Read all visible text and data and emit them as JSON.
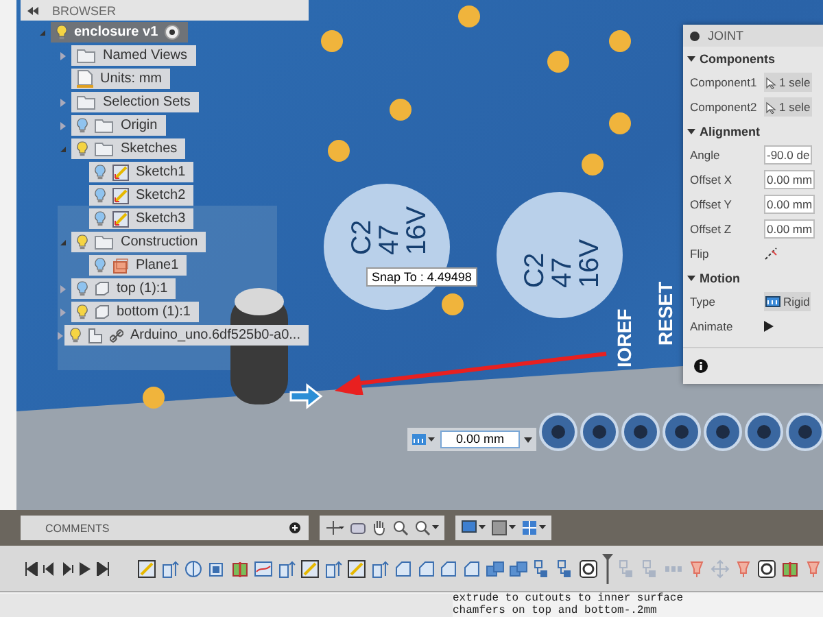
{
  "browser": {
    "title": "BROWSER",
    "root": {
      "label": "enclosure v1",
      "expanded": true,
      "visible": true,
      "children": [
        {
          "label": "Named Views",
          "kind": "folder",
          "expanded": false
        },
        {
          "label": "Units: mm",
          "kind": "units"
        },
        {
          "label": "Selection Sets",
          "kind": "folder",
          "expanded": false
        },
        {
          "label": "Origin",
          "kind": "folder",
          "visible": false,
          "expanded": false
        },
        {
          "label": "Sketches",
          "kind": "folder",
          "visible": true,
          "expanded": true,
          "children": [
            {
              "label": "Sketch1",
              "kind": "sketch",
              "visible": false
            },
            {
              "label": "Sketch2",
              "kind": "sketch",
              "visible": false
            },
            {
              "label": "Sketch3",
              "kind": "sketch",
              "visible": false
            }
          ]
        },
        {
          "label": "Construction",
          "kind": "folder",
          "visible": true,
          "expanded": true,
          "children": [
            {
              "label": "Plane1",
              "kind": "plane",
              "visible": false
            }
          ]
        },
        {
          "label": "top (1):1",
          "kind": "body",
          "visible": false,
          "expanded": false
        },
        {
          "label": "bottom (1):1",
          "kind": "body",
          "visible": true,
          "expanded": false
        },
        {
          "label": "Arduino_uno.6df525b0-a0...",
          "kind": "link",
          "visible": true,
          "expanded": false
        }
      ]
    }
  },
  "viewport": {
    "board_labels": [
      {
        "text": "C2"
      },
      {
        "text": "47"
      },
      {
        "text": "16V"
      },
      {
        "text": "C2"
      },
      {
        "text": "47"
      },
      {
        "text": "16V"
      },
      {
        "text": "IOREF"
      },
      {
        "text": "RESET"
      }
    ],
    "snap_tooltip": "Snap To : 4.49498",
    "distance_value": "0.00 mm"
  },
  "joint": {
    "title": "JOINT",
    "sections": [
      {
        "title": "Components",
        "expanded": true,
        "rows": [
          {
            "label": "Component1",
            "kind": "selection",
            "value": "1 sele"
          },
          {
            "label": "Component2",
            "kind": "selection",
            "value": "1 sele"
          }
        ]
      },
      {
        "title": "Alignment",
        "expanded": true,
        "rows": [
          {
            "label": "Angle",
            "kind": "input",
            "value": "-90.0 de"
          },
          {
            "label": "Offset X",
            "kind": "input",
            "value": "0.00 mm"
          },
          {
            "label": "Offset Y",
            "kind": "input",
            "value": "0.00 mm"
          },
          {
            "label": "Offset Z",
            "kind": "input",
            "value": "0.00 mm"
          },
          {
            "label": "Flip",
            "kind": "flip"
          }
        ]
      },
      {
        "title": "Motion",
        "expanded": true,
        "rows": [
          {
            "label": "Type",
            "kind": "type",
            "value": "Rigid"
          },
          {
            "label": "Animate",
            "kind": "play"
          }
        ]
      }
    ]
  },
  "comments": {
    "title": "COMMENTS"
  },
  "notes": [
    "extrude to cutouts to inner surface",
    "chamfers on top and bottom-.2mm"
  ]
}
